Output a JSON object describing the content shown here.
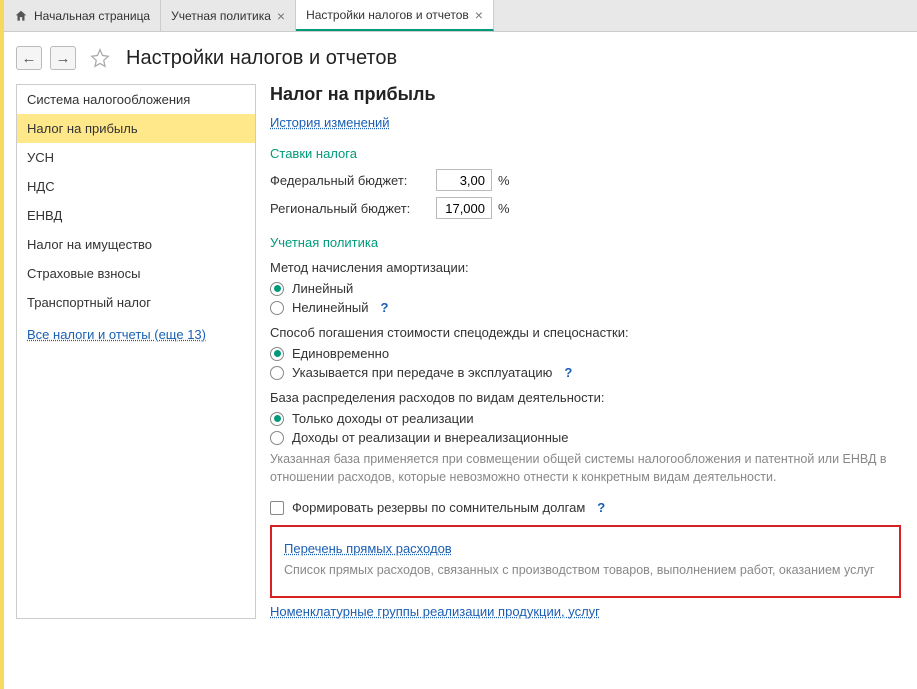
{
  "tabs": {
    "home": "Начальная страница",
    "t1": "Учетная политика",
    "t2": "Настройки налогов и отчетов"
  },
  "page_title": "Настройки налогов и отчетов",
  "sidebar": {
    "items": [
      "Система налогообложения",
      "Налог на прибыль",
      "УСН",
      "НДС",
      "ЕНВД",
      "Налог на имущество",
      "Страховые взносы",
      "Транспортный налог"
    ],
    "all_link": "Все налоги и отчеты (еще 13)"
  },
  "main": {
    "heading": "Налог на прибыль",
    "history_link": "История изменений",
    "rates_title": "Ставки налога",
    "fed_label": "Федеральный бюджет:",
    "fed_value": "3,00",
    "reg_label": "Региональный бюджет:",
    "reg_value": "17,000",
    "pct": "%",
    "policy_title": "Учетная политика",
    "amort_label": "Метод начисления амортизации:",
    "amort_linear": "Линейный",
    "amort_nonlinear": "Нелинейный",
    "workwear_label": "Способ погашения стоимости спецодежды и спецоснастки:",
    "workwear_once": "Единовременно",
    "workwear_onissue": "Указывается при передаче в эксплуатацию",
    "base_label": "База распределения расходов по видам деятельности:",
    "base_sales": "Только доходы от реализации",
    "base_all": "Доходы от реализации и внереализационные",
    "base_hint": "Указанная база применяется при совмещении общей системы налогообложения и патентной или ЕНВД в отношении расходов, которые невозможно отнести к конкретным видам деятельности.",
    "reserves_label": "Формировать резервы по сомнительным долгам",
    "direct_link": "Перечень прямых расходов",
    "direct_hint": "Список прямых расходов, связанных с производством товаров, выполнением работ, оказанием услуг",
    "nomen_link": "Номенклатурные группы реализации продукции, услуг",
    "qmark": "?"
  }
}
